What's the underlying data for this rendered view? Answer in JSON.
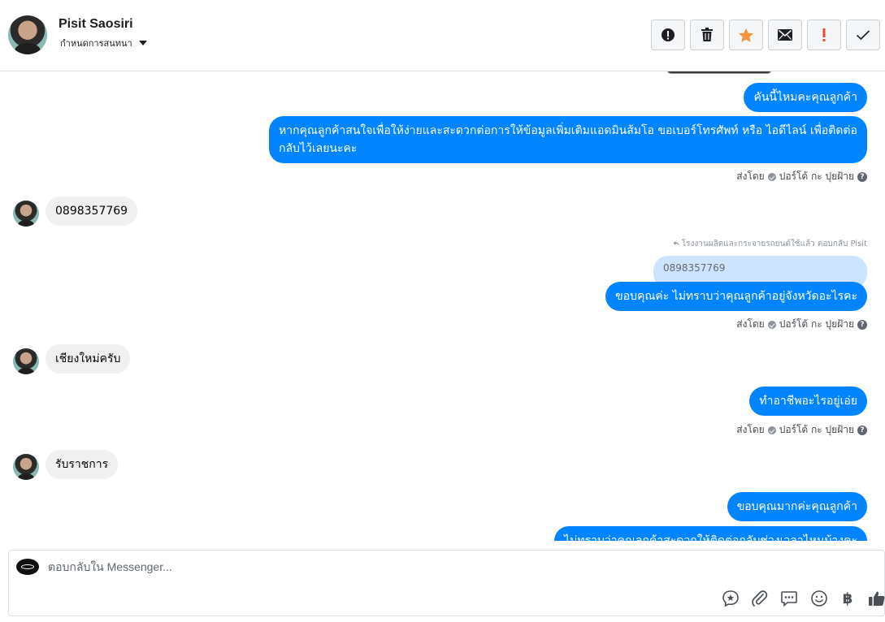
{
  "header": {
    "contact_name": "Pisit Saosiri",
    "assign_label": "กำหนดการสนทนา",
    "actions": [
      {
        "name": "spam-button",
        "icon": "alert-circle-icon"
      },
      {
        "name": "delete-button",
        "icon": "trash-icon"
      },
      {
        "name": "star-button",
        "icon": "star-icon"
      },
      {
        "name": "mark-unread-button",
        "icon": "envelope-icon"
      },
      {
        "name": "important-button",
        "icon": "exclamation-icon"
      },
      {
        "name": "done-button",
        "icon": "check-icon"
      }
    ]
  },
  "messages": {
    "m1": "คันนี้ไหมคะคุณลูกค้า",
    "m2": "หากคุณลูกค้าสนใจเพื่อให้ง่ายและสะดวกต่อการให้ข้อมูลเพิ่มเติมแอดมินส้มโอ ขอเบอร์โทรศัพท์ หรือ ไอดีไลน์ เพื่อติดต่อกลับไว้เลยนะคะ",
    "m3": "0898357769",
    "m4_reply_meta": "โรงงานผลิตและกระจายรถยนต์ใช้แล้ว ตอบกลับ Pisit",
    "m4_quote": "0898357769",
    "m4": "ขอบคุณค่ะ ไม่ทราบว่าคุณลูกค้าอยู่จังหวัดอะไรคะ",
    "m5": "เชียงใหม่ครับ",
    "m6": "ทำอาชีพอะไรอยู่เอ่ย",
    "m7": "รับราชการ",
    "m8": "ขอบคุณมากค่ะคุณลูกค้า",
    "m9": "ไม่ทราบว่าคุณลูกค้าสะดวกให้ติดต่อกลับช่วงเวลาไหนบ้างคะ"
  },
  "sent_by": {
    "prefix": "ส่งโดย",
    "agent": "ปอร์โต้ กะ ปุยฝ้าย",
    "help": "?"
  },
  "composer": {
    "placeholder": "ตอบกลับใน Messenger...",
    "tools": [
      "saved-reply-icon",
      "attachment-icon",
      "chat-bubble-icon",
      "emoji-icon",
      "baht-icon",
      "thumbs-up-icon"
    ],
    "baht_symbol": "฿"
  },
  "colors": {
    "outgoing_bubble": "#0084ff",
    "incoming_bubble": "#f0f0f0",
    "star": "#f7923b",
    "important": "#e94b35"
  }
}
